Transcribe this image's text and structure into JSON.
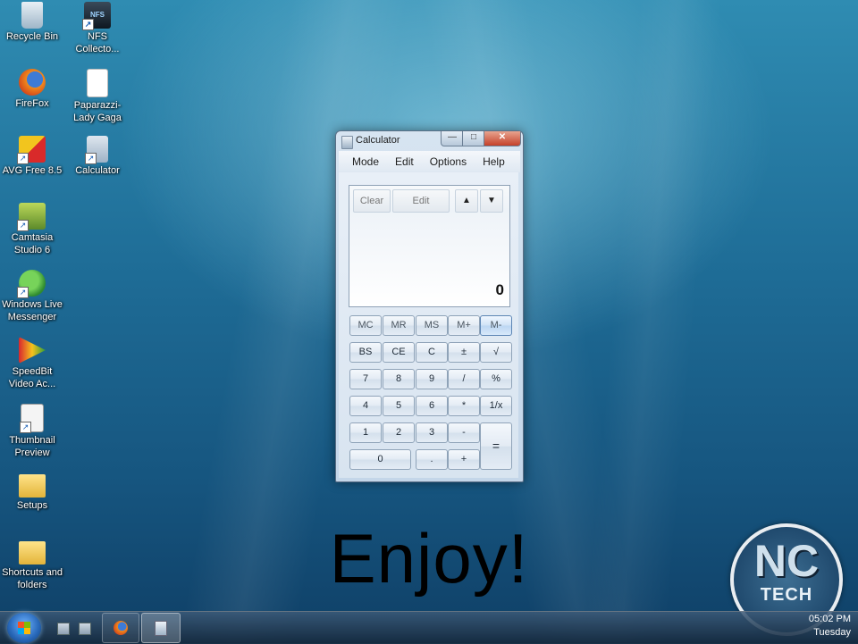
{
  "desktop_icons": [
    {
      "label": "Recycle Bin",
      "icon": "recycle-bin-icon"
    },
    {
      "label": "NFS\nCollecto...",
      "icon": "nfs-collection-icon"
    },
    {
      "label": "FireFox",
      "icon": "firefox-icon"
    },
    {
      "label": "Paparazzi-\nLady Gaga",
      "icon": "document-icon"
    },
    {
      "label": "AVG Free 8.5",
      "icon": "avg-icon"
    },
    {
      "label": "Calculator",
      "icon": "calculator-shortcut-icon"
    },
    {
      "label": "Camtasia\nStudio 6",
      "icon": "camtasia-icon"
    },
    {
      "label": "Windows Live\nMessenger",
      "icon": "messenger-icon"
    },
    {
      "label": "SpeedBit\nVideo Ac...",
      "icon": "speedbit-icon"
    },
    {
      "label": "Thumbnail\nPreview",
      "icon": "thumbnail-preview-icon"
    },
    {
      "label": "Setups",
      "icon": "folder-icon"
    },
    {
      "label": "Shortcuts and\nfolders",
      "icon": "folder-icon"
    }
  ],
  "calculator": {
    "title": "Calculator",
    "menu": [
      "Mode",
      "Edit",
      "Options",
      "Help"
    ],
    "history": {
      "clear": "Clear",
      "edit": "Edit",
      "up": "▲",
      "down": "▼"
    },
    "display_value": "0",
    "keys": {
      "mc": "MC",
      "mr": "MR",
      "ms": "MS",
      "mplus": "M+",
      "mminus": "M-",
      "bs": "BS",
      "ce": "CE",
      "c": "C",
      "plusminus": "±",
      "sqrt": "√",
      "k7": "7",
      "k8": "8",
      "k9": "9",
      "div": "/",
      "pct": "%",
      "k4": "4",
      "k5": "5",
      "k6": "6",
      "mul": "*",
      "recip": "1/x",
      "k1": "1",
      "k2": "2",
      "k3": "3",
      "sub": "-",
      "eq": "=",
      "k0": "0",
      "dot": ".",
      "add": "+"
    },
    "window_buttons": {
      "minimize": "—",
      "maximize": "□",
      "close": "✕"
    }
  },
  "overlay_text": "Enjoy!",
  "logo": {
    "line1": "NC",
    "line2": "TECH"
  },
  "taskbar": {
    "clock_time": "05:02 PM",
    "clock_day": "Tuesday"
  }
}
